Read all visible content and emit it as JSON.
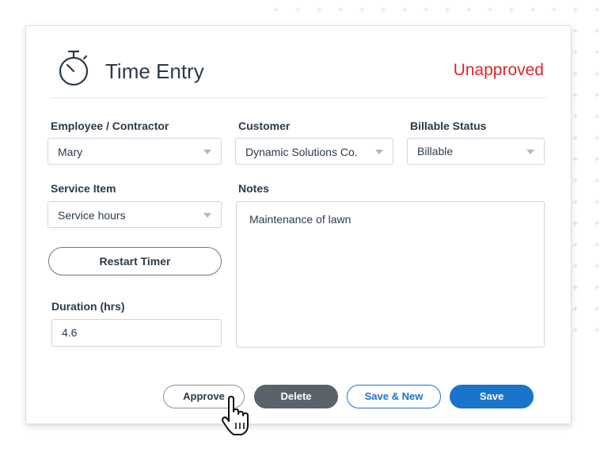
{
  "header": {
    "title": "Time Entry",
    "status": "Unapproved",
    "status_color": "#d7282f",
    "icon": "stopwatch-icon"
  },
  "fields": {
    "employee": {
      "label": "Employee / Contractor",
      "value": "Mary"
    },
    "customer": {
      "label": "Customer",
      "value": "Dynamic Solutions Co."
    },
    "billable": {
      "label": "Billable Status",
      "value": "Billable"
    },
    "service": {
      "label": "Service Item",
      "value": "Service hours"
    },
    "notes": {
      "label": "Notes",
      "value": "Maintenance of lawn"
    },
    "duration": {
      "label": "Duration (hrs)",
      "value": "4.6"
    }
  },
  "buttons": {
    "restart": "Restart Timer",
    "approve": "Approve",
    "delete": "Delete",
    "save_new": "Save & New",
    "save": "Save"
  },
  "colors": {
    "accent": "#1a74c9",
    "dark_button": "#5a636c",
    "text": "#2b3a4a"
  }
}
